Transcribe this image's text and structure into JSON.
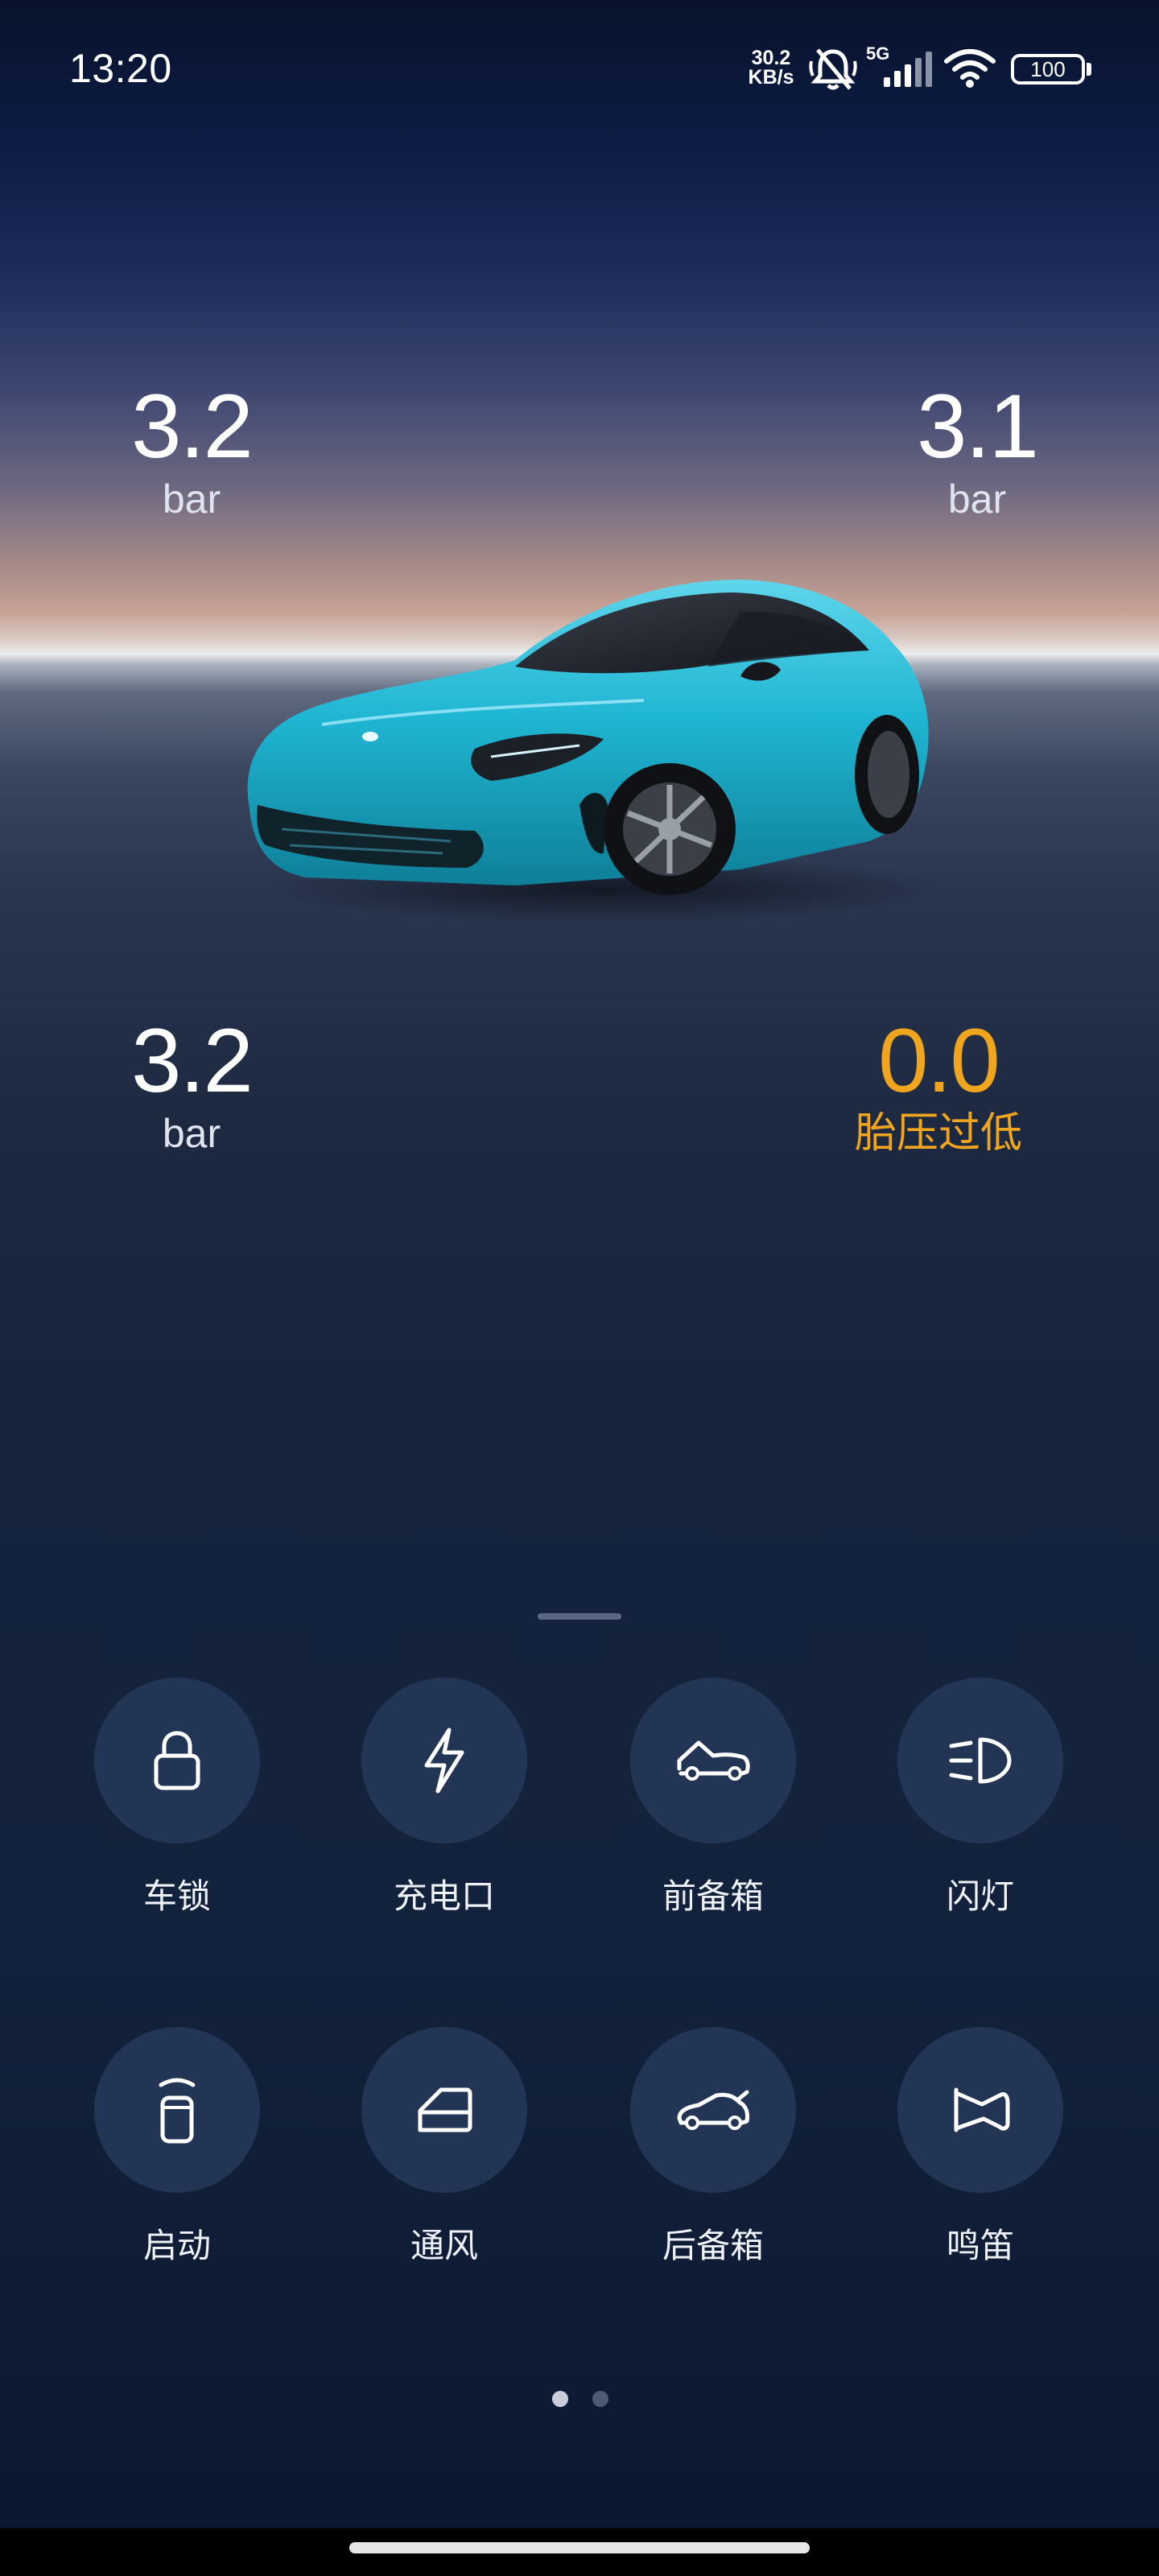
{
  "status_bar": {
    "time": "13:20",
    "net_speed_value": "30.2",
    "net_speed_unit": "KB/s",
    "network_type": "5G",
    "battery": "100",
    "icons": [
      "mute-bell-icon",
      "signal-icon",
      "wifi-icon",
      "battery-icon"
    ]
  },
  "tires": {
    "front_left": {
      "value": "3.2",
      "unit": "bar"
    },
    "front_right": {
      "value": "3.1",
      "unit": "bar"
    },
    "rear_left": {
      "value": "3.2",
      "unit": "bar"
    },
    "rear_right": {
      "value": "0.0",
      "unit": "胎压过低"
    }
  },
  "colors": {
    "warning": "#f0a51f",
    "car_body": "#1fb6d3",
    "control_bg": "#223554"
  },
  "controls": [
    {
      "label": "车锁",
      "icon": "lock-icon"
    },
    {
      "label": "充电口",
      "icon": "lightning-icon"
    },
    {
      "label": "前备箱",
      "icon": "front-trunk-icon"
    },
    {
      "label": "闪灯",
      "icon": "headlight-icon"
    },
    {
      "label": "启动",
      "icon": "start-icon"
    },
    {
      "label": "通风",
      "icon": "window-vent-icon"
    },
    {
      "label": "后备箱",
      "icon": "rear-trunk-icon"
    },
    {
      "label": "鸣笛",
      "icon": "horn-icon"
    }
  ],
  "pagination": {
    "current": 1,
    "total": 2
  }
}
